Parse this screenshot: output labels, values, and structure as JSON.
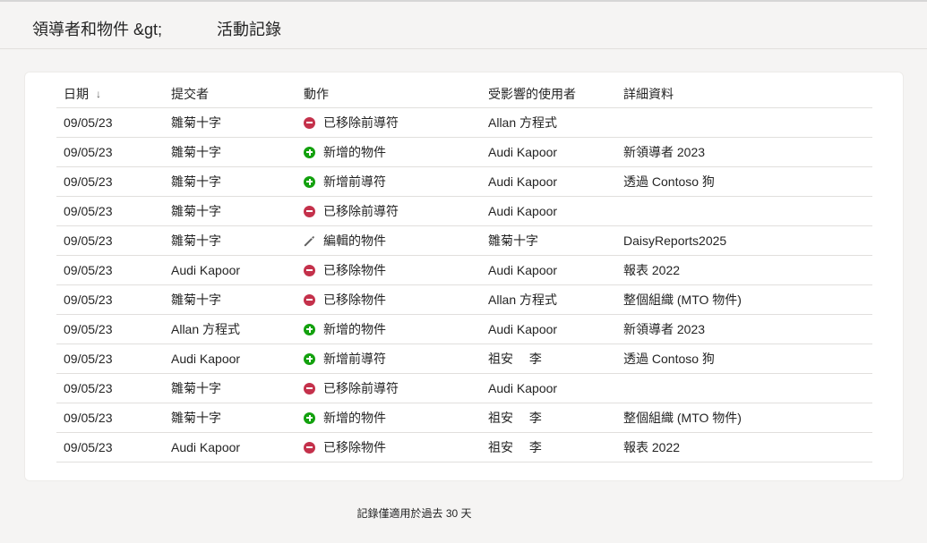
{
  "breadcrumb": {
    "root": "領導者和物件 &gt;",
    "current": "活動記錄"
  },
  "table": {
    "headers": {
      "date": "日期",
      "submitter": "提交者",
      "action": "動作",
      "affected_user": "受影響的使用者",
      "details": "詳細資料"
    },
    "sort_column": "date",
    "sort_direction": "descending",
    "rows": [
      {
        "date": "09/05/23",
        "submitter": "雛菊十字",
        "action_icon": "removed-icon",
        "action": "已移除前導符",
        "affected_user": "Allan 方程式",
        "details": ""
      },
      {
        "date": "09/05/23",
        "submitter": "雛菊十字",
        "action_icon": "added-icon",
        "action": "新增的物件",
        "affected_user": "Audi Kapoor",
        "details": "新領導者 2023"
      },
      {
        "date": "09/05/23",
        "submitter": "雛菊十字",
        "action_icon": "added-icon",
        "action": "新增前導符",
        "affected_user": "Audi Kapoor",
        "details": "透過 Contoso 狗"
      },
      {
        "date": "09/05/23",
        "submitter": "雛菊十字",
        "action_icon": "removed-icon",
        "action": "已移除前導符",
        "affected_user": "Audi Kapoor",
        "details": ""
      },
      {
        "date": "09/05/23",
        "submitter": "雛菊十字",
        "action_icon": "edit-icon",
        "action": "編輯的物件",
        "affected_user": "雛菊十字",
        "details": "DaisyReports2025"
      },
      {
        "date": "09/05/23",
        "submitter": "Audi Kapoor",
        "action_icon": "removed-icon",
        "action": "已移除物件",
        "affected_user": "Audi Kapoor",
        "details": "報表 2022"
      },
      {
        "date": "09/05/23",
        "submitter": "雛菊十字",
        "action_icon": "removed-icon",
        "action": "已移除物件",
        "affected_user": "Allan 方程式",
        "details": "整個組織 (MTO 物件)"
      },
      {
        "date": "09/05/23",
        "submitter": "Allan 方程式",
        "action_icon": "added-icon",
        "action": "新增的物件",
        "affected_user": "Audi Kapoor",
        "details": "新領導者 2023"
      },
      {
        "date": "09/05/23",
        "submitter": "Audi Kapoor",
        "action_icon": "added-icon",
        "action": "新增前導符",
        "affected_user": "祖安　 李",
        "details": "透過 Contoso 狗"
      },
      {
        "date": "09/05/23",
        "submitter": "雛菊十字",
        "action_icon": "removed-icon",
        "action": "已移除前導符",
        "affected_user": "Audi Kapoor",
        "details": ""
      },
      {
        "date": "09/05/23",
        "submitter": "雛菊十字",
        "action_icon": "added-icon",
        "action": "新增的物件",
        "affected_user": "祖安　 李",
        "details": "整個組織 (MTO 物件)"
      },
      {
        "date": "09/05/23",
        "submitter": "Audi Kapoor",
        "action_icon": "removed-icon",
        "action": "已移除物件",
        "affected_user": "祖安　 李",
        "details": "報表 2022"
      }
    ]
  },
  "footer": {
    "note": "記錄僅適用於過去 30 天"
  },
  "colors": {
    "removed": "#c4314b",
    "added": "#13a10e",
    "edit": "#616161",
    "divider": "#e1dfdd",
    "background": "#f5f4f3",
    "card": "#ffffff"
  }
}
